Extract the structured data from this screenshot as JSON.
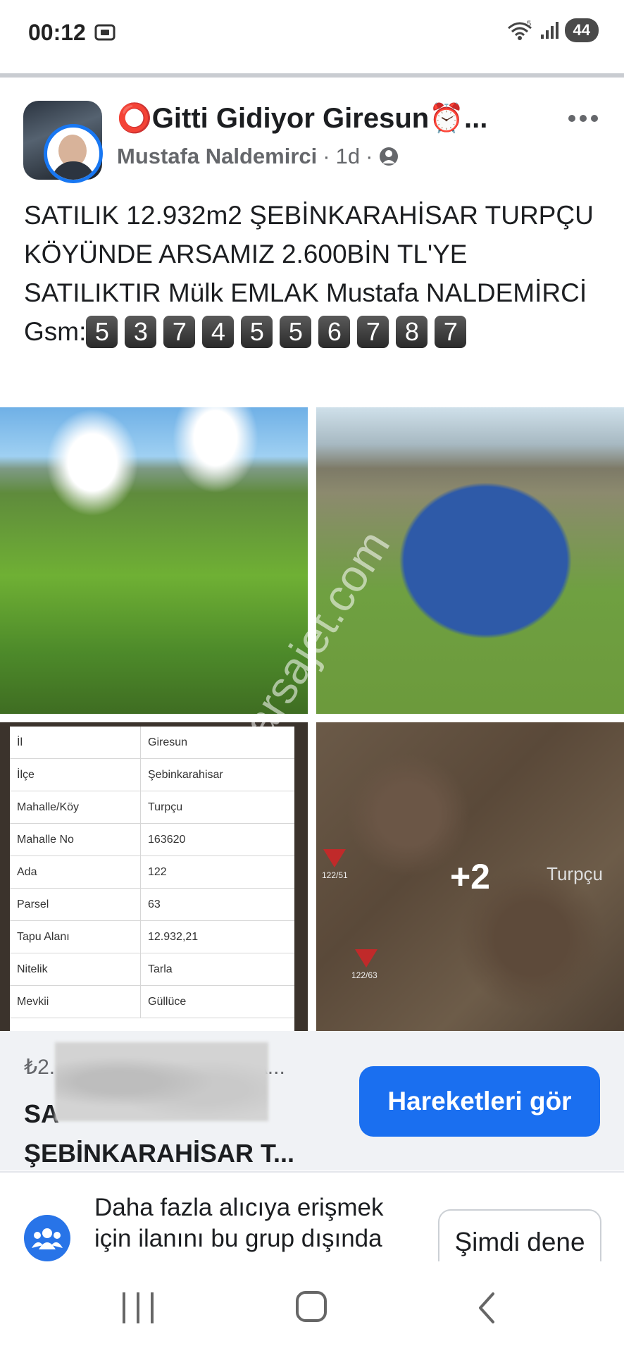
{
  "status_bar": {
    "time": "00:12",
    "wifi_badge": "5",
    "battery": "44"
  },
  "post": {
    "group_name": "⭕Gitti Gidiyor Giresun⏰...",
    "author": "Mustafa Naldemirci",
    "age": "1d",
    "separator": "·",
    "text": "SATILIK 12.932m2 ŞEBİNKARAHİSAR TURPÇU KÖYÜNDE ARSAMIZ 2.600BİN TL'YE SATILIKTIR Mülk EMLAK Mustafa NALDEMİRCİ",
    "gsm_label": "Gsm:",
    "gsm_digits": [
      "5",
      "3",
      "7",
      "4",
      "5",
      "5",
      "6",
      "7",
      "8",
      "7"
    ]
  },
  "photos": {
    "more_count": "+2",
    "watermark": "arsajet.com",
    "map_place_label": "Turpçu",
    "map_parcel_tags": [
      "122/51",
      "122/63"
    ],
    "tapu_rows": [
      {
        "key": "İl",
        "value": "Giresun"
      },
      {
        "key": "İlçe",
        "value": "Şebinkarahisar"
      },
      {
        "key": "Mahalle/Köy",
        "value": "Turpçu"
      },
      {
        "key": "Mahalle No",
        "value": "163620"
      },
      {
        "key": "Ada",
        "value": "122"
      },
      {
        "key": "Parsel",
        "value": "63"
      },
      {
        "key": "Tapu Alanı",
        "value": "12.932,21"
      },
      {
        "key": "Nitelik",
        "value": "Tarla"
      },
      {
        "key": "Mevkii",
        "value": "Güllüce"
      }
    ]
  },
  "product": {
    "price": "₺2.",
    "price_tail": "RA...",
    "title_line1": "SA",
    "title_line2": "ŞEBİNKARAHİSAR T...",
    "action_label": "Hareketleri gör"
  },
  "promo": {
    "text": "Daha fazla alıcıya erişmek için ilanını bu grup dışında",
    "button_label": "Şimdi dene"
  },
  "colors": {
    "accent": "#1a6ff0",
    "avatar_ring": "#1877f2",
    "meta_text": "#65676b"
  },
  "icons": [
    "screenshot-icon",
    "wifi-icon",
    "signal-icon",
    "more-icon",
    "globe-icon",
    "group-icon",
    "recents-icon",
    "home-icon",
    "back-icon"
  ]
}
